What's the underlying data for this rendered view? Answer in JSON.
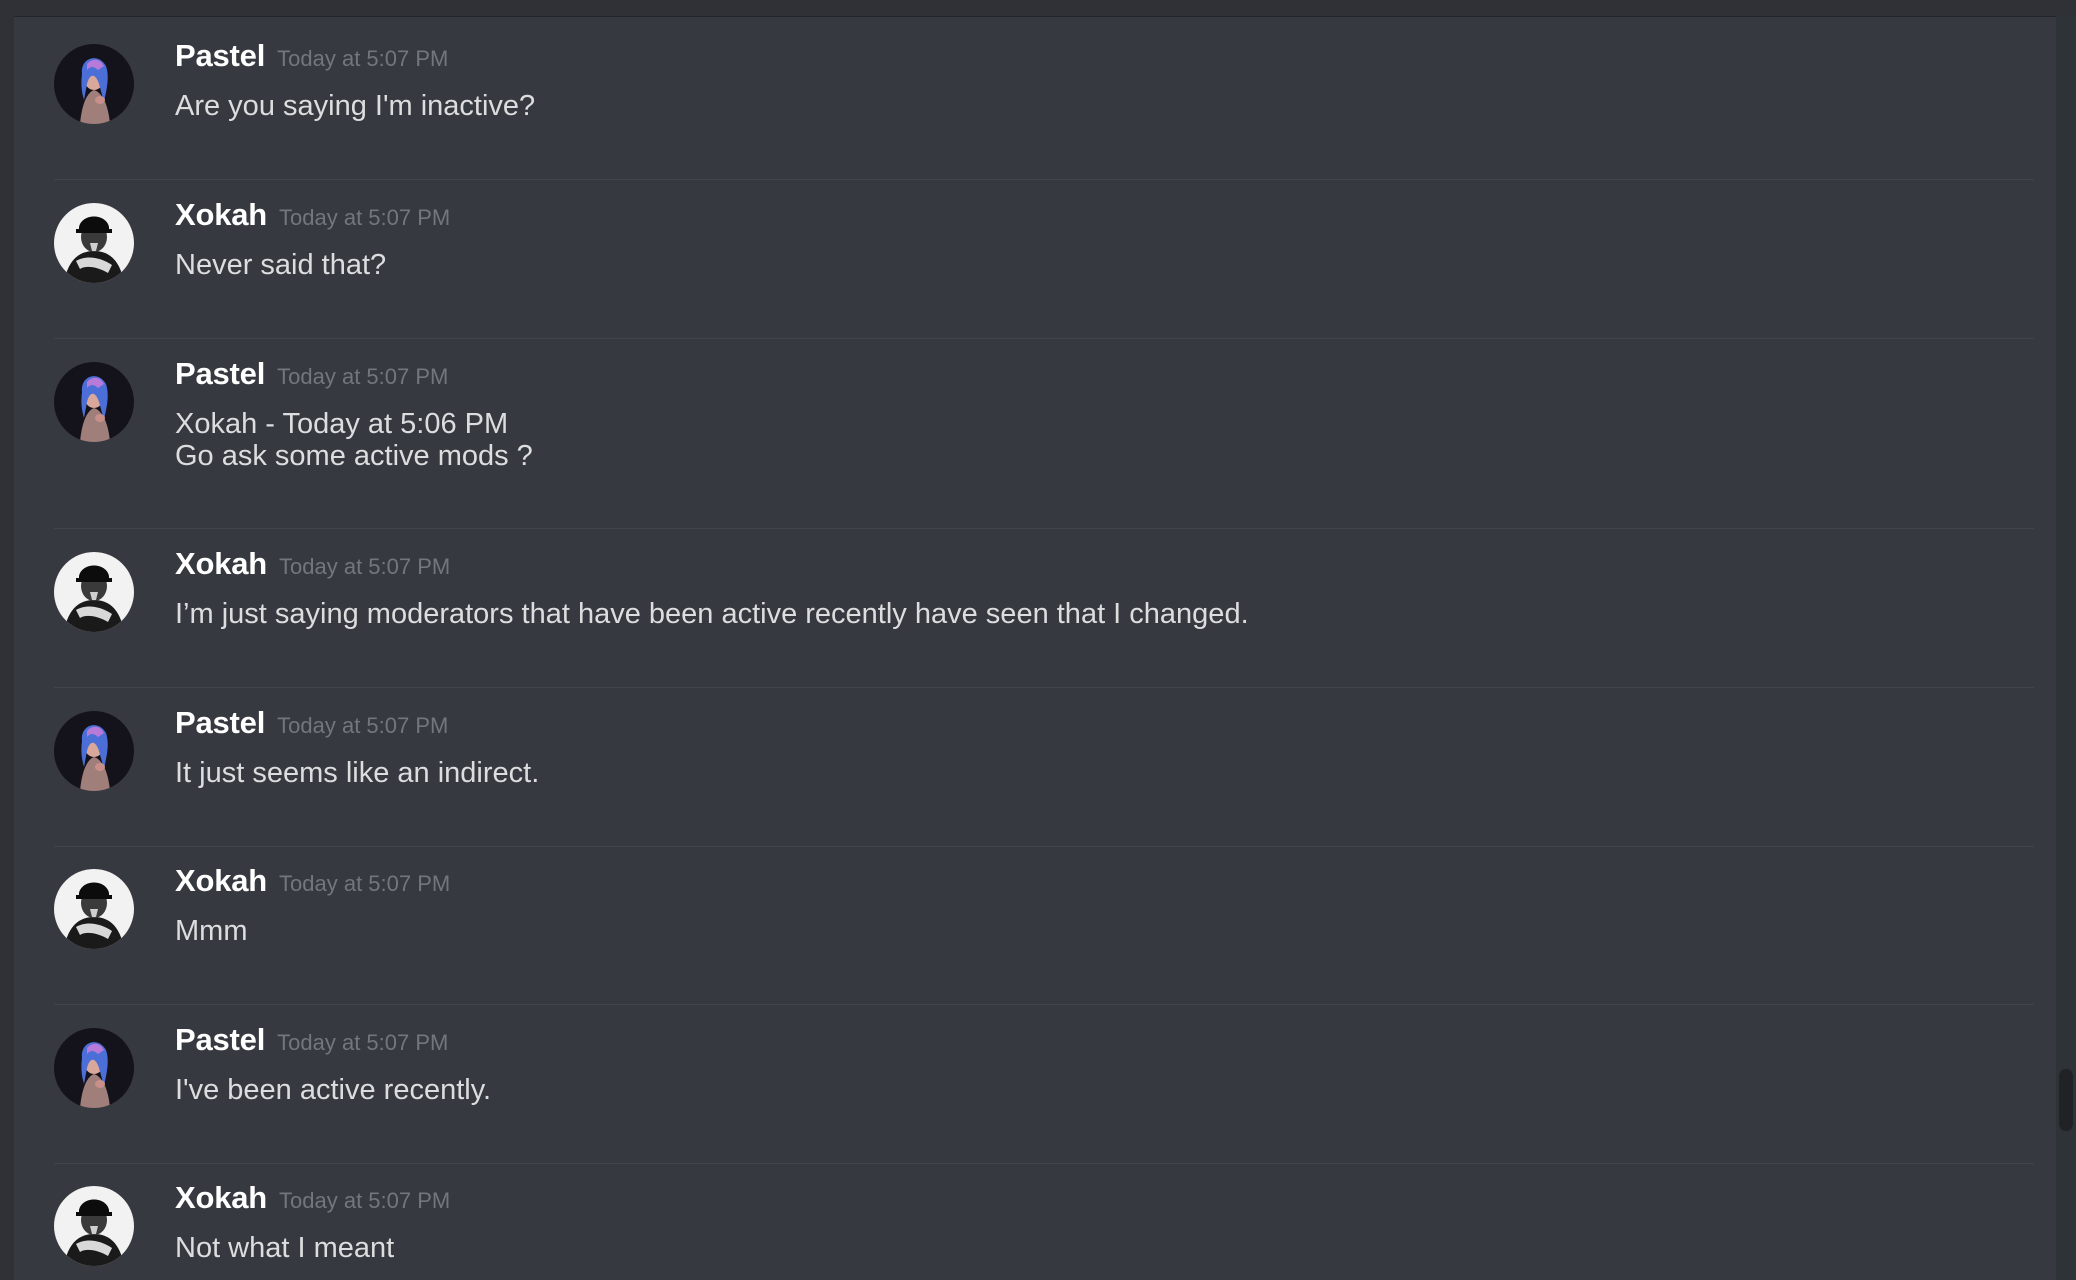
{
  "messages": [
    {
      "author": "Pastel",
      "timestamp": "Today at 5:07 PM",
      "lines": [
        "Are you saying I'm inactive?"
      ]
    },
    {
      "author": "Xokah",
      "timestamp": "Today at 5:07 PM",
      "lines": [
        "Never said that?"
      ]
    },
    {
      "author": "Pastel",
      "timestamp": "Today at 5:07 PM",
      "lines": [
        "Xokah - Today at 5:06 PM",
        "Go ask some active mods ?"
      ]
    },
    {
      "author": "Xokah",
      "timestamp": "Today at 5:07 PM",
      "lines": [
        "I’m just saying moderators that have been active recently have seen that I changed."
      ]
    },
    {
      "author": "Pastel",
      "timestamp": "Today at 5:07 PM",
      "lines": [
        "It just seems like an indirect."
      ]
    },
    {
      "author": "Xokah",
      "timestamp": "Today at 5:07 PM",
      "lines": [
        "Mmm"
      ]
    },
    {
      "author": "Pastel",
      "timestamp": "Today at 5:07 PM",
      "lines": [
        "I've been active recently."
      ]
    },
    {
      "author": "Xokah",
      "timestamp": "Today at 5:07 PM",
      "lines": [
        "Not what I meant"
      ]
    }
  ],
  "colors": {
    "background": "#36393f",
    "username": "#ffffff",
    "timestamp": "#72767d",
    "message_text": "#dcddde",
    "divider": "#40444b"
  },
  "icons": {
    "pastel_avatar": "avatar-pastel-icon",
    "xokah_avatar": "avatar-xokah-icon"
  }
}
